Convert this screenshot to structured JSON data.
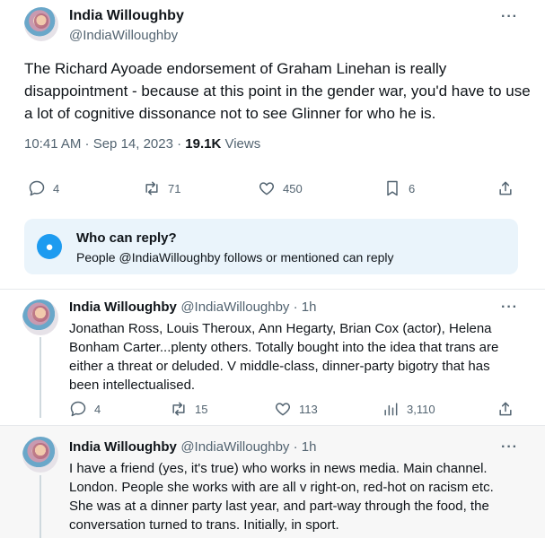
{
  "main_tweet": {
    "author_name": "India Willoughby",
    "author_handle": "@IndiaWilloughby",
    "text": "The Richard Ayoade endorsement of Graham Linehan is really disappointment - because at this point in the gender war, you'd have to use a lot of cognitive dissonance not to see Glinner for who he is.",
    "time": "10:41 AM · Sep 14, 2023 · ",
    "views_count": "19.1K",
    "views_label": " Views",
    "actions": {
      "replies": "4",
      "reposts": "71",
      "likes": "450",
      "bookmarks": "6"
    }
  },
  "who_can_reply": {
    "title": "Who can reply?",
    "subtitle": "People @IndiaWilloughby follows or mentioned can reply"
  },
  "replies": [
    {
      "author_name": "India Willoughby",
      "meta": "@IndiaWilloughby · 1h",
      "text": "Jonathan Ross, Louis Theroux, Ann Hegarty, Brian Cox (actor), Helena Bonham Carter...plenty others. Totally bought into the idea that trans are either a threat or deluded. V middle-class, dinner-party bigotry that has been intellectualised.",
      "actions": {
        "replies": "4",
        "reposts": "15",
        "likes": "113",
        "views": "3,110"
      }
    },
    {
      "author_name": "India Willoughby",
      "meta": "@IndiaWilloughby · 1h",
      "text": "I have a friend (yes, it's true) who works in news media. Main channel. London. People she works with are all v right-on, red-hot on racism etc. She was at a dinner party last year, and part-way through the food, the conversation turned to trans. Initially, in sport."
    }
  ],
  "more_label": "···"
}
